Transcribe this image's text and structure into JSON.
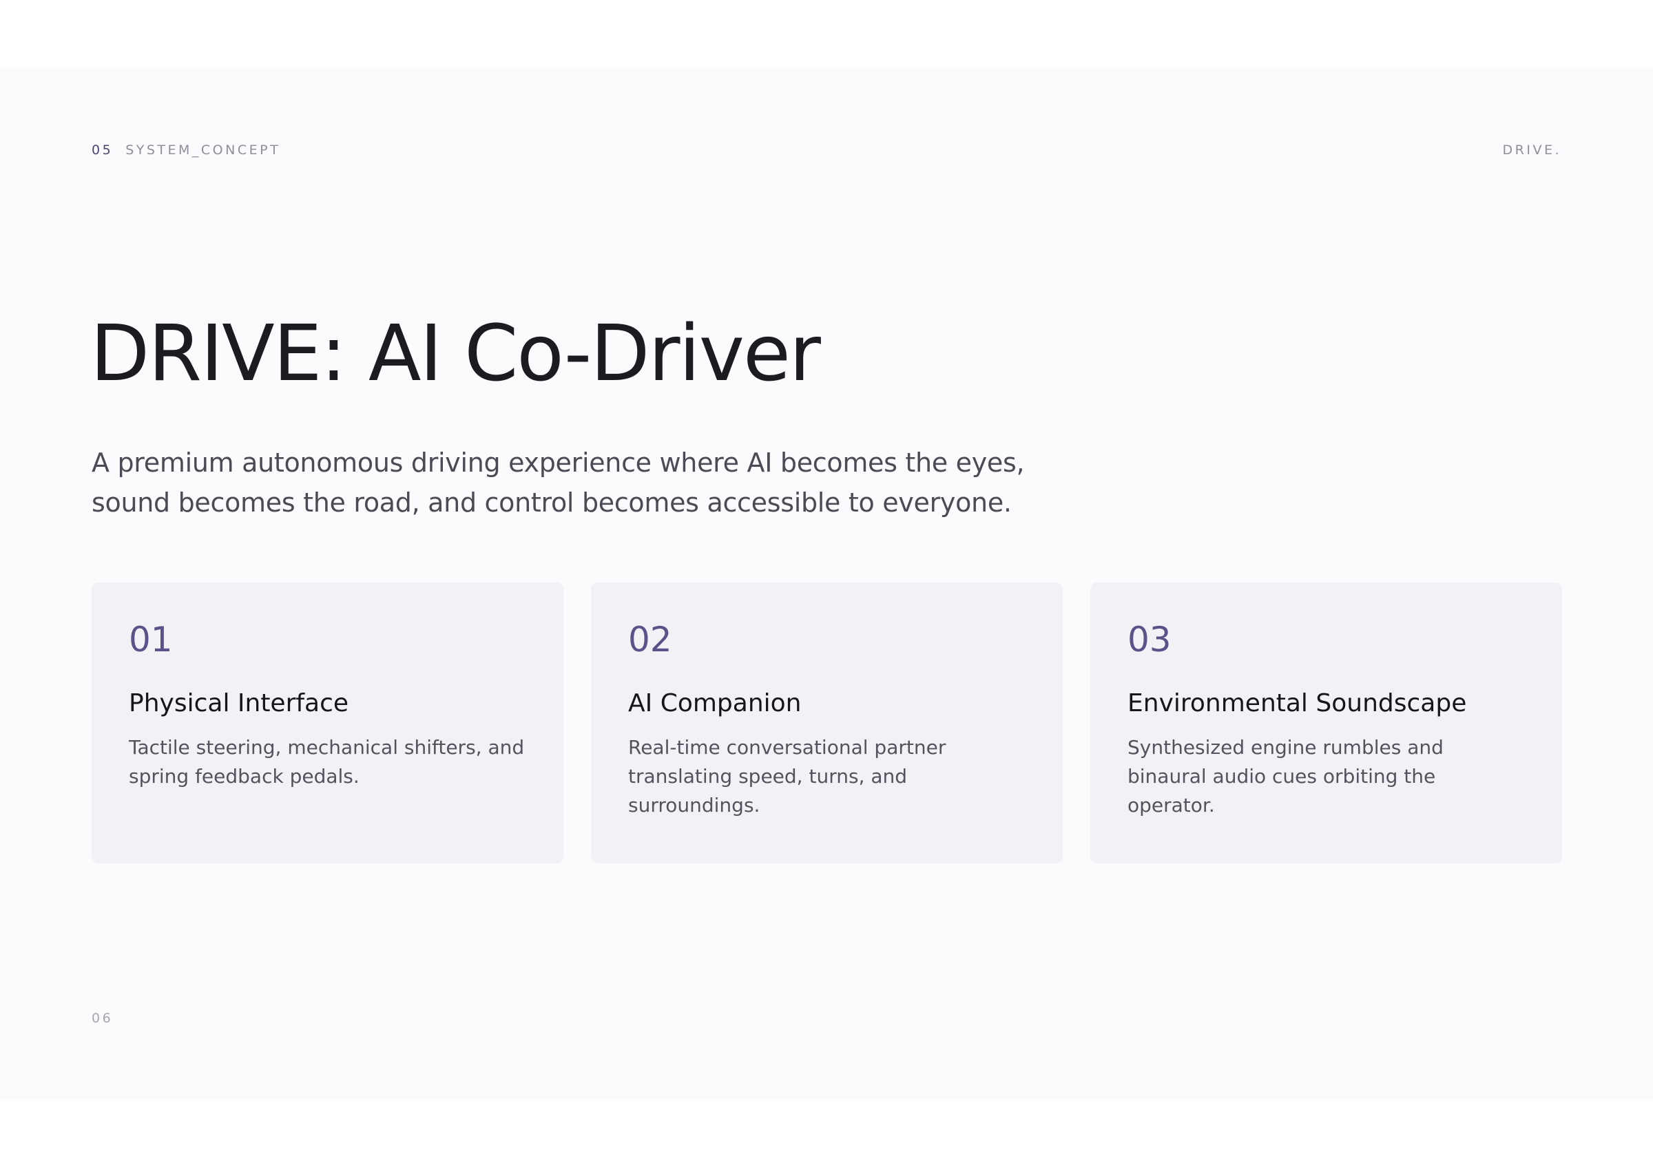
{
  "header": {
    "section_number": "05",
    "section_label": "SYSTEM_CONCEPT",
    "brand": "DRIVE."
  },
  "hero": {
    "title": "DRIVE: AI Co-Driver",
    "subtitle": "A premium autonomous driving experience where AI becomes the eyes, sound becomes the road, and control becomes accessible to everyone."
  },
  "cards": [
    {
      "number": "01",
      "title": "Physical Interface",
      "description": "Tactile steering, mechanical shifters, and spring feedback pedals."
    },
    {
      "number": "02",
      "title": "AI Companion",
      "description": "Real-time conversational partner translating speed, turns, and surroundings."
    },
    {
      "number": "03",
      "title": "Environmental Soundscape",
      "description": "Synthesized engine rumbles and binaural audio cues orbiting the operator."
    }
  ],
  "footer": {
    "page_number": "06"
  },
  "colors": {
    "accent": "#5a5289",
    "title_text": "#1b1c22",
    "slide_background": "#fbfbfd",
    "card_background": "#f2f2f6"
  }
}
